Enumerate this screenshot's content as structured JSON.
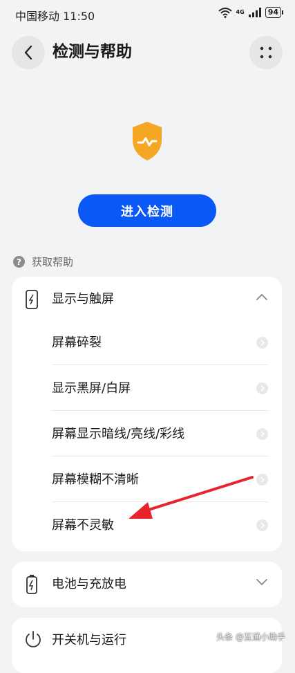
{
  "status_bar": {
    "carrier_time": "中国移动 11:50",
    "network": "4G",
    "battery": "94"
  },
  "header": {
    "title": "检测与帮助",
    "back_icon": "chevron-left-icon",
    "more_icon": "more-dots-icon"
  },
  "hero": {
    "icon": "shield-icon",
    "accent": "#f5a623",
    "button_label": "进入检测",
    "button_color": "#0a59f7"
  },
  "help": {
    "title": "获取帮助",
    "categories": [
      {
        "label": "显示与触屏",
        "icon": "phone-screen-icon",
        "expanded": true,
        "items": [
          "屏幕碎裂",
          "显示黑屏/白屏",
          "屏幕显示暗线/亮线/彩线",
          "屏幕模糊不清晰",
          "屏幕不灵敏"
        ]
      },
      {
        "label": "电池与充放电",
        "icon": "battery-charging-icon",
        "expanded": false
      },
      {
        "label": "开关机与运行",
        "icon": "power-icon",
        "expanded": false
      }
    ]
  },
  "annotation": {
    "arrow_color": "#e8232b"
  },
  "watermark": "头条 @互通小助手"
}
